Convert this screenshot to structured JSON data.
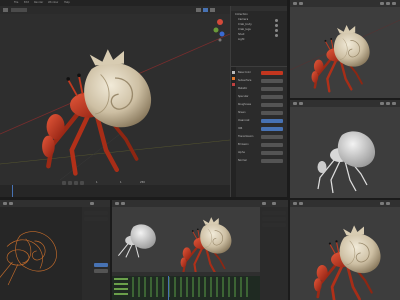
{
  "app": {
    "name": "Blender",
    "subject": "hermit crab 3D model"
  },
  "main_window": {
    "menu": [
      "File",
      "Edit",
      "Render",
      "Window",
      "Help"
    ],
    "outliner": {
      "items": [
        "Collection",
        "Camera",
        "Crab_body",
        "Crab_legs",
        "Shell",
        "Light"
      ]
    },
    "properties": {
      "rows": [
        "Base Color",
        "Subsurface",
        "Metallic",
        "Specular",
        "Roughness",
        "Sheen",
        "Clearcoat",
        "IOR",
        "Transmission",
        "Emission",
        "Alpha",
        "Normal"
      ]
    },
    "timeline": {
      "frame_current": "1",
      "frame_start": "1",
      "frame_end": "250"
    }
  },
  "thumbnails": [
    {
      "label": "solid-view-top-right"
    },
    {
      "label": "clay-render"
    },
    {
      "label": "wireframe-xray"
    },
    {
      "label": "animation-timeline"
    },
    {
      "label": "final-render"
    }
  ],
  "colors": {
    "ui_bg": "#1b1b1b",
    "viewport": "#3d3d3d",
    "header": "#303030",
    "accent_blue": "#4772b3",
    "accent_orange": "#e0782c",
    "crab_red": "#c3361f",
    "shell": "#cfc4ad"
  }
}
